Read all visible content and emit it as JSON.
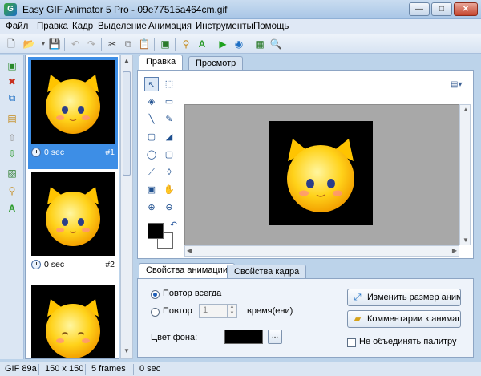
{
  "window": {
    "title": "Easy GIF Animator 5 Pro - 09e77515a464cm.gif",
    "minimize_glyph": "—",
    "maximize_glyph": "□",
    "close_glyph": "✕"
  },
  "menu": {
    "items": [
      "Файл",
      "Правка",
      "Кадр",
      "Выделение",
      "Анимация",
      "Инструменты",
      "Помощь"
    ]
  },
  "frames": {
    "items": [
      {
        "time": "0 sec",
        "number": "#1"
      },
      {
        "time": "0 sec",
        "number": "#2"
      },
      {
        "time": "",
        "number": ""
      }
    ]
  },
  "editor": {
    "tabs": [
      "Правка",
      "Просмотр"
    ],
    "active_tab": "Правка"
  },
  "properties": {
    "tabs": [
      "Свойства анимации",
      "Свойства кадра"
    ],
    "repeat_always_label": "Повтор всегда",
    "repeat_label": "Повтор",
    "repeat_count_value": "1",
    "times_label": "время(ени)",
    "background_color_label": "Цвет фона:",
    "dots_button": "...",
    "resize_button": "Изменить размер анимации",
    "comments_button": "Комментарии к анимации",
    "no_merge_palette_label": "Не объединять палитру"
  },
  "status": {
    "format": "GIF 89a",
    "size": "150 x 150",
    "frames": "5 frames",
    "duration": "0 sec"
  },
  "colors": {
    "accent_selected": "#3d8ee6",
    "background_color": "#000000",
    "canvas_gray": "#a8a8a8"
  }
}
